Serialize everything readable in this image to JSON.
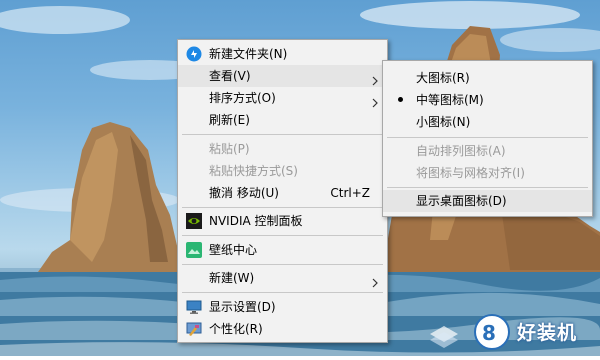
{
  "context_menu": {
    "items": [
      {
        "label": "新建文件夹(N)",
        "icon": "new-folder-icon"
      },
      {
        "label": "查看(V)",
        "has_submenu": true
      },
      {
        "label": "排序方式(O)",
        "has_submenu": true
      },
      {
        "label": "刷新(E)"
      },
      {
        "label": "粘贴(P)",
        "disabled": true
      },
      {
        "label": "粘贴快捷方式(S)",
        "disabled": true
      },
      {
        "label": "撤消 移动(U)",
        "shortcut": "Ctrl+Z"
      },
      {
        "label": "NVIDIA 控制面板",
        "icon": "nvidia-icon"
      },
      {
        "label": "壁纸中心",
        "icon": "wallpaper-icon"
      },
      {
        "label": "新建(W)",
        "has_submenu": true
      },
      {
        "label": "显示设置(D)",
        "icon": "display-settings-icon"
      },
      {
        "label": "个性化(R)",
        "icon": "personalize-icon"
      }
    ]
  },
  "view_submenu": {
    "items": [
      {
        "label": "大图标(R)"
      },
      {
        "label": "中等图标(M)",
        "selected": true
      },
      {
        "label": "小图标(N)"
      },
      {
        "label": "自动排列图标(A)",
        "disabled": true
      },
      {
        "label": "将图标与网格对齐(I)",
        "disabled": true
      },
      {
        "label": "显示桌面图标(D)"
      }
    ]
  },
  "watermark": {
    "text": "好装机"
  },
  "colors": {
    "menu_bg": "#f2f2f2",
    "hover_bg": "#e5e5e5",
    "disabled_text": "#9a9a9a",
    "nvidia_green": "#76b900",
    "folder_blue": "#1e88e5"
  }
}
